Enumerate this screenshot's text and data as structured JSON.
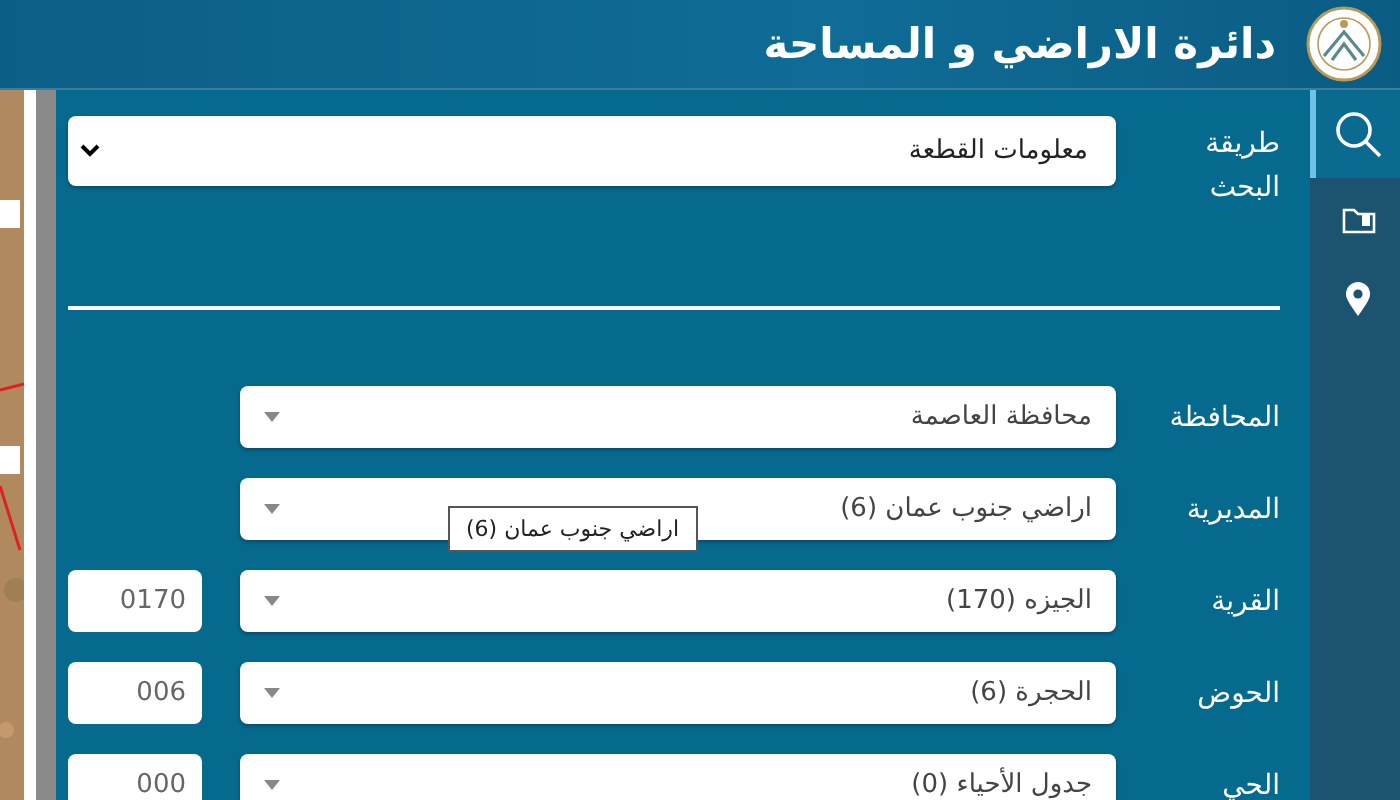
{
  "header": {
    "title": "دائرة الاراضي و المساحة"
  },
  "nav": [
    {
      "kind": "search",
      "selected": true
    },
    {
      "kind": "folder",
      "selected": false
    },
    {
      "kind": "pin",
      "selected": false
    }
  ],
  "search_method": {
    "label": "طريقة البحث",
    "value": "معلومات القطعة"
  },
  "fields": [
    {
      "label": "المحافظة",
      "value": "محافظة العاصمة"
    },
    {
      "label": "المديرية",
      "value": "اراضي جنوب عمان (6)"
    },
    {
      "label": "القرية",
      "value": "الجيزه (170)",
      "code": "0170"
    },
    {
      "label": "الحوض",
      "value": "الحجرة (6)",
      "code": "006"
    },
    {
      "label": "الحي",
      "value": "جدول الأحياء (0)",
      "code": "000"
    }
  ],
  "tooltip": {
    "text": "اراضي جنوب عمان (6)"
  }
}
